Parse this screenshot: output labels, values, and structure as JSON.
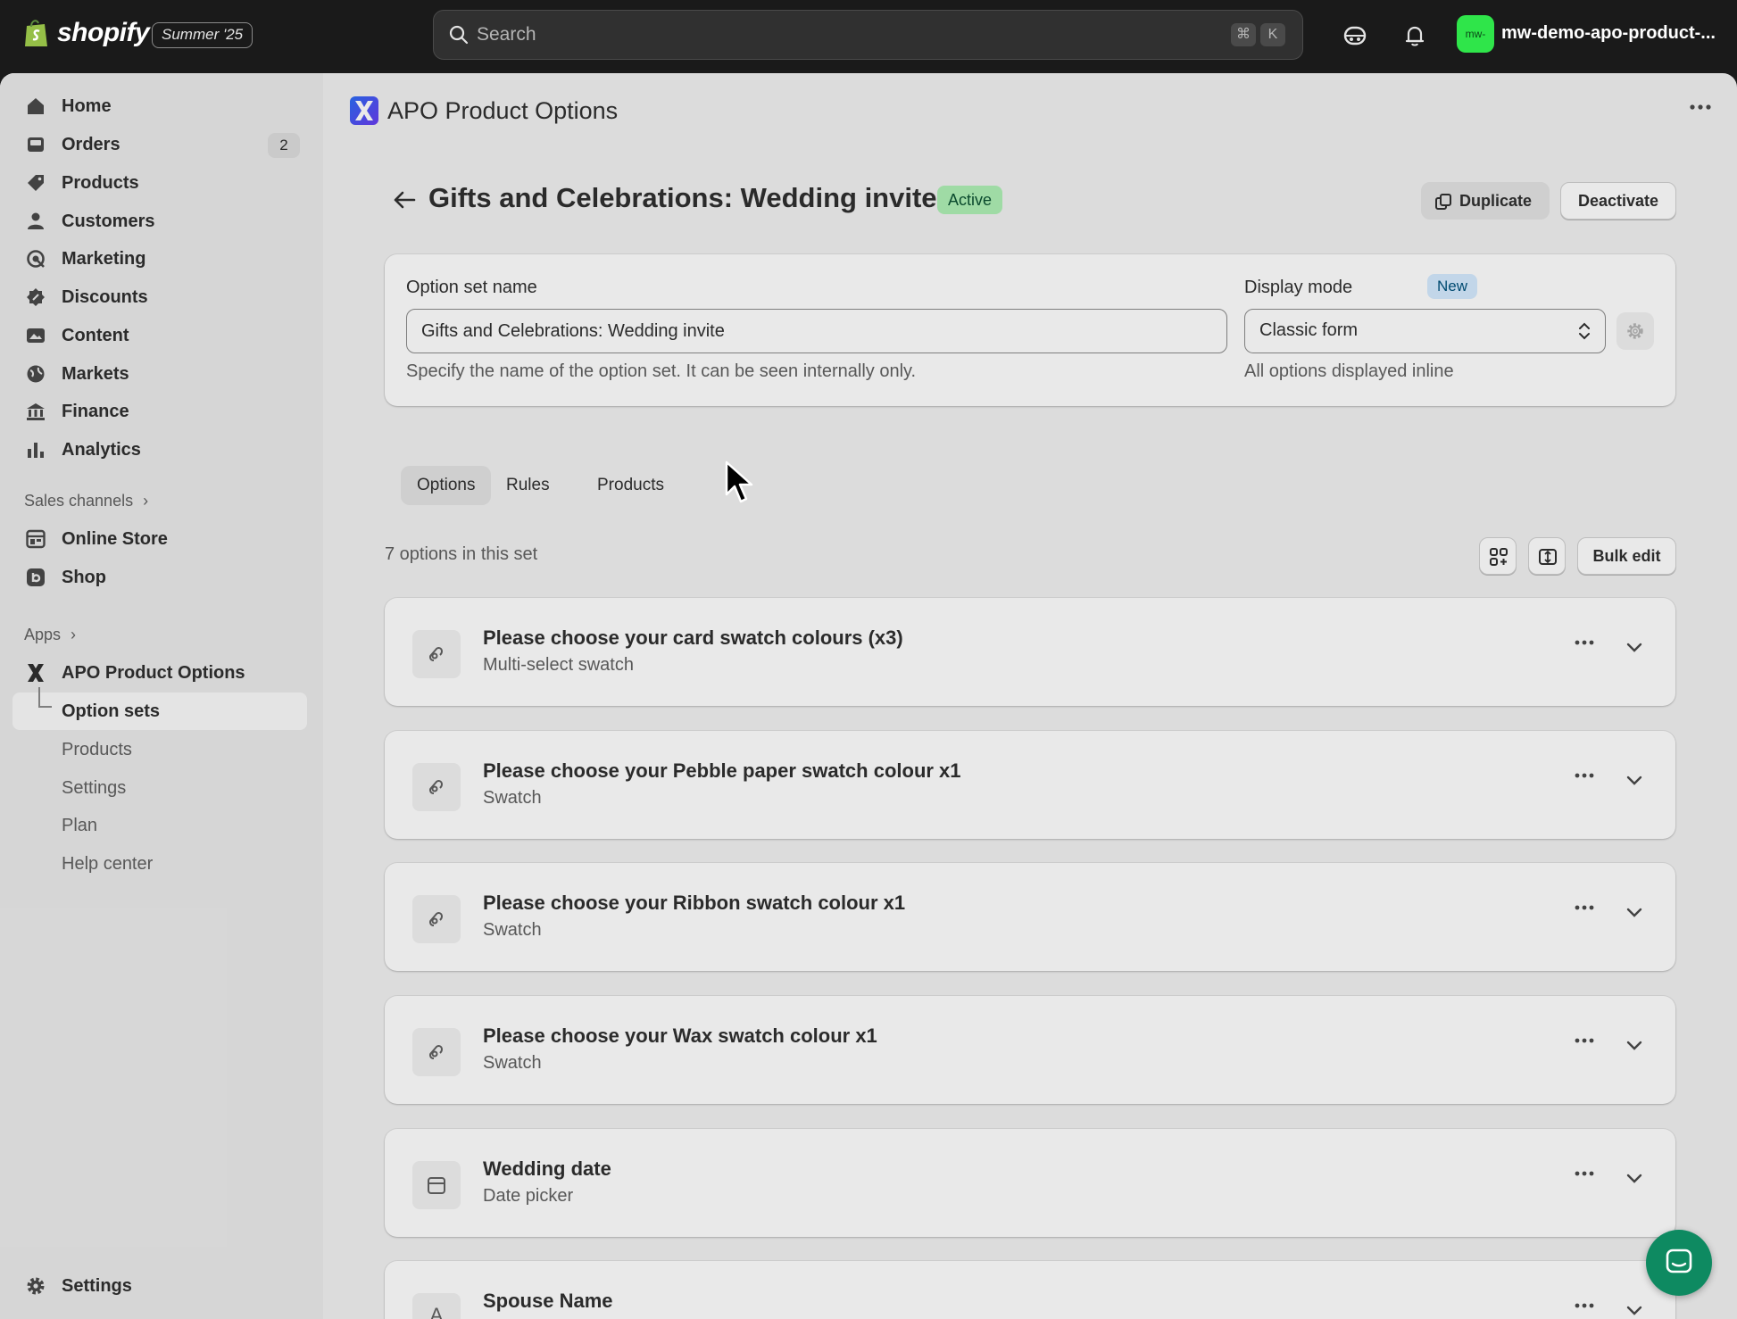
{
  "topbar": {
    "brand": "shopify",
    "edition_badge": "Summer '25",
    "search_placeholder": "Search",
    "shortcut_keys": [
      "⌘",
      "K"
    ],
    "store_avatar": "mw-",
    "store_name": "mw-demo-apo-product-..."
  },
  "sidebar": {
    "main_items": [
      {
        "label": "Home",
        "icon": "home-icon"
      },
      {
        "label": "Orders",
        "icon": "orders-icon",
        "count": "2"
      },
      {
        "label": "Products",
        "icon": "tag-icon"
      },
      {
        "label": "Customers",
        "icon": "person-icon"
      },
      {
        "label": "Marketing",
        "icon": "target-icon"
      },
      {
        "label": "Discounts",
        "icon": "discount-icon"
      },
      {
        "label": "Content",
        "icon": "content-icon"
      },
      {
        "label": "Markets",
        "icon": "globe-icon"
      },
      {
        "label": "Finance",
        "icon": "bank-icon"
      },
      {
        "label": "Analytics",
        "icon": "bar-chart-icon"
      }
    ],
    "sales_channels_label": "Sales channels",
    "channels": [
      {
        "label": "Online Store",
        "icon": "store-icon"
      },
      {
        "label": "Shop",
        "icon": "shop-icon"
      }
    ],
    "apps_label": "Apps",
    "app_name": "APO Product Options",
    "app_subitems": [
      "Option sets",
      "Products",
      "Settings",
      "Plan",
      "Help center"
    ],
    "settings_label": "Settings"
  },
  "main": {
    "app_title": "APO Product Options",
    "page_title": "Gifts and Celebrations: Wedding invite",
    "status": "Active",
    "duplicate_label": "Duplicate",
    "deactivate_label": "Deactivate",
    "form": {
      "name_label": "Option set name",
      "name_value": "Gifts and Celebrations: Wedding invite",
      "name_help": "Specify the name of the option set. It can be seen internally only.",
      "display_label": "Display mode",
      "display_badge": "New",
      "display_value": "Classic form",
      "display_help": "All options displayed inline"
    },
    "tabs": [
      "Options",
      "Rules",
      "Products"
    ],
    "options_count": "7 options in this set",
    "bulk_edit_label": "Bulk edit",
    "options": [
      {
        "title": "Please choose your card swatch colours (x3)",
        "type": "Multi-select swatch",
        "icon": "swatch-icon"
      },
      {
        "title": "Please choose your Pebble paper swatch colour x1",
        "type": "Swatch",
        "icon": "swatch-icon"
      },
      {
        "title": "Please choose your Ribbon swatch colour x1",
        "type": "Swatch",
        "icon": "swatch-icon"
      },
      {
        "title": "Please choose your Wax swatch colour x1",
        "type": "Swatch",
        "icon": "swatch-icon"
      },
      {
        "title": "Wedding date",
        "type": "Date picker",
        "icon": "calendar-icon"
      },
      {
        "title": "Spouse Name",
        "type": "",
        "icon": "text-icon",
        "icon_letter": "A"
      }
    ]
  },
  "colors": {
    "topbar_bg": "#1a1a1a",
    "active_badge_bg": "#aff0b5",
    "new_badge_bg": "#d5ebff",
    "chat_button": "#0e8a61",
    "store_avatar_bg": "#2fe54a"
  }
}
